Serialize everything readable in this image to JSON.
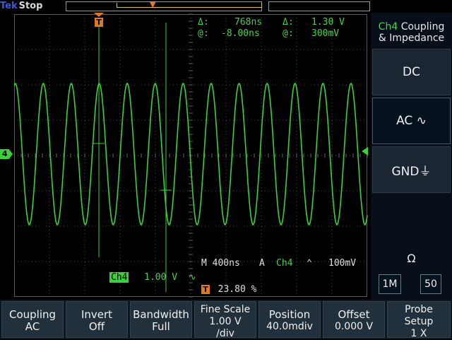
{
  "top_bar": {
    "brand": "Tek",
    "state": "Stop"
  },
  "trigger_marker": "T",
  "channel_marker": "4",
  "cursor_readout": {
    "delta_t_label": "Δ:",
    "delta_t": "768ns",
    "delta_v_label": "Δ:",
    "delta_v": "1.30 V",
    "at_t_label": "@:",
    "at_t": "-8.00ns",
    "at_v_label": "@:",
    "at_v": "300mV"
  },
  "channel_readout": {
    "label": "Ch4",
    "scale": "1.00 V",
    "coupling_symbol": "∿"
  },
  "horizontal_readout": {
    "scale": "M 400ns",
    "mode": "A",
    "source": "Ch4",
    "slope_symbol": "⌃",
    "level": "100mV"
  },
  "trigger_position": {
    "icon": "T",
    "value": "23.80 %"
  },
  "side_menu": {
    "title_channel": "Ch4",
    "title_rest": "Coupling",
    "title_line2": "& Impedance",
    "options": [
      "DC",
      "AC ∿",
      "GND⏚"
    ],
    "selected": "AC",
    "impedance_label": "Ω",
    "impedance_options": [
      "1M",
      "50"
    ]
  },
  "bottom_menu": [
    {
      "label": "Coupling",
      "value": "AC"
    },
    {
      "label": "Invert",
      "value": "Off"
    },
    {
      "label": "Bandwidth",
      "value": "Full"
    },
    {
      "label": "Fine Scale",
      "value": "1.00 V",
      "value2": "/div"
    },
    {
      "label": "Position",
      "value": "40.0mdiv"
    },
    {
      "label": "Offset",
      "value": "0.000 V"
    },
    {
      "label": "Probe",
      "value": "Setup",
      "value2": "1 X"
    }
  ],
  "colors": {
    "trace": "#3ad13a",
    "channel4": "#49d14c",
    "trigger": "#e07a1c",
    "brand": "#3b5bd6"
  }
}
